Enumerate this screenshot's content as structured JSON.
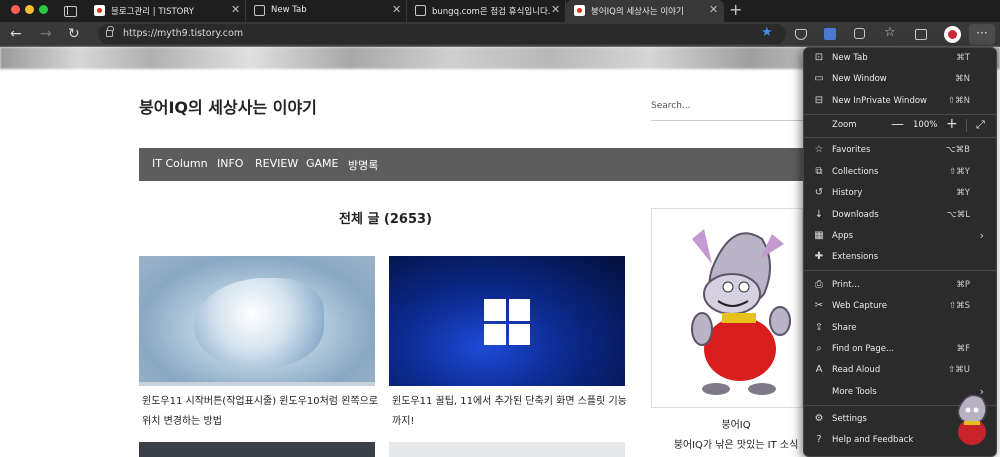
{
  "tabs": [
    {
      "title": "블로그관리 | TISTORY",
      "favicon": "tistory-icon"
    },
    {
      "title": "New Tab",
      "favicon": "page-icon"
    },
    {
      "title": "bungq.com은 점검 휴식입니다.",
      "favicon": "page-icon"
    },
    {
      "title": "붕어IQ의 세상사는 이야기",
      "favicon": "tistory-icon",
      "active": true
    }
  ],
  "toolbar": {
    "url": "https://myth9.tistory.com",
    "new_tab_symbol": "+",
    "close_symbol": "✕",
    "back_symbol": "←",
    "forward_symbol": "→",
    "reload_symbol": "↻",
    "favorite_star": "★",
    "more_symbol": "···"
  },
  "blog": {
    "title": "붕어IQ의 세상사는 이야기",
    "search_placeholder": "Search...",
    "nav": [
      "IT Column",
      "INFO",
      "REVIEW",
      "GAME",
      "방명록"
    ],
    "post_count_heading": "전체 글 (2653)",
    "posts": [
      {
        "title": "윈도우11 시작버튼(작업표시줄) 윈도우10처럼 왼쪽으로 위치 변경하는 방법"
      },
      {
        "title": "윈도우11 꿀팁, 11에서 추가된 단축키 화면 스플릿 기능까지!"
      }
    ],
    "profile": {
      "name": "붕어IQ",
      "description": "붕어IQ가 낚은 맛있는 IT 소식"
    }
  },
  "menu": {
    "items": [
      {
        "icon": "new-tab-icon",
        "glyph": "⊡",
        "label": "New Tab",
        "shortcut": "⌘T"
      },
      {
        "icon": "new-window-icon",
        "glyph": "▭",
        "label": "New Window",
        "shortcut": "⌘N"
      },
      {
        "icon": "inprivate-icon",
        "glyph": "⊟",
        "label": "New InPrivate Window",
        "shortcut": "⇧⌘N"
      },
      {
        "icon": "zoom-icon",
        "glyph": "",
        "label": "Zoom",
        "zoom": "100%"
      },
      {
        "icon": "favorites-icon",
        "glyph": "☆",
        "label": "Favorites",
        "shortcut": "⌥⌘B"
      },
      {
        "icon": "collections-icon",
        "glyph": "⧉",
        "label": "Collections",
        "shortcut": "⇧⌘Y"
      },
      {
        "icon": "history-icon",
        "glyph": "↺",
        "label": "History",
        "shortcut": "⌘Y"
      },
      {
        "icon": "downloads-icon",
        "glyph": "↓",
        "label": "Downloads",
        "shortcut": "⌥⌘L"
      },
      {
        "icon": "apps-icon",
        "glyph": "▦",
        "label": "Apps",
        "submenu": true
      },
      {
        "icon": "extensions-icon",
        "glyph": "✚",
        "label": "Extensions"
      },
      {
        "icon": "print-icon",
        "glyph": "⎙",
        "label": "Print...",
        "shortcut": "⌘P"
      },
      {
        "icon": "web-capture-icon",
        "glyph": "✂",
        "label": "Web Capture",
        "shortcut": "⇧⌘S"
      },
      {
        "icon": "share-icon",
        "glyph": "⇪",
        "label": "Share"
      },
      {
        "icon": "find-icon",
        "glyph": "⌕",
        "label": "Find on Page...",
        "shortcut": "⌘F"
      },
      {
        "icon": "read-aloud-icon",
        "glyph": "A",
        "label": "Read Aloud",
        "shortcut": "⇧⌘U"
      },
      {
        "icon": "more-tools-icon",
        "glyph": "",
        "label": "More Tools",
        "submenu": true
      },
      {
        "icon": "settings-icon",
        "glyph": "⚙",
        "label": "Settings"
      },
      {
        "icon": "help-icon",
        "glyph": "?",
        "label": "Help and Feedback"
      }
    ],
    "zoom": {
      "minus": "—",
      "value": "100%",
      "plus": "+",
      "fullscreen": "⤢"
    }
  },
  "colors": {
    "chrome_bg": "#1e1e1e",
    "toolbar_bg": "#383838",
    "menu_bg": "#2b2b2b",
    "navbar_bg": "#5d5d5d",
    "accent_star": "#3b8eea"
  }
}
